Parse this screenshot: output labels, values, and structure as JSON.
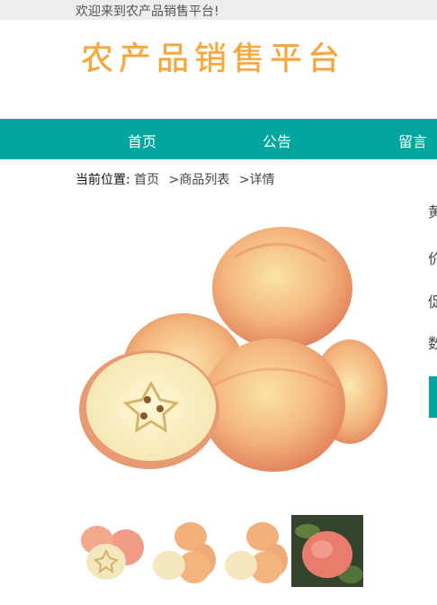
{
  "topbar": {
    "welcome": "欢迎来到农产品销售平台!"
  },
  "logo": {
    "text": "农产品销售平台"
  },
  "nav": {
    "items": [
      {
        "label": "首页"
      },
      {
        "label": "公告"
      },
      {
        "label": "留言"
      }
    ]
  },
  "breadcrumb": {
    "label": "当前位置:",
    "home": "首页",
    "list": ">商品列表",
    "detail": ">详情"
  },
  "product": {
    "side_glyphs": [
      "黄",
      "价",
      "促",
      "数"
    ]
  },
  "colors": {
    "accent": "#03a69f",
    "logo": "#f6a63a",
    "topbar_bg": "#eeeeee"
  }
}
